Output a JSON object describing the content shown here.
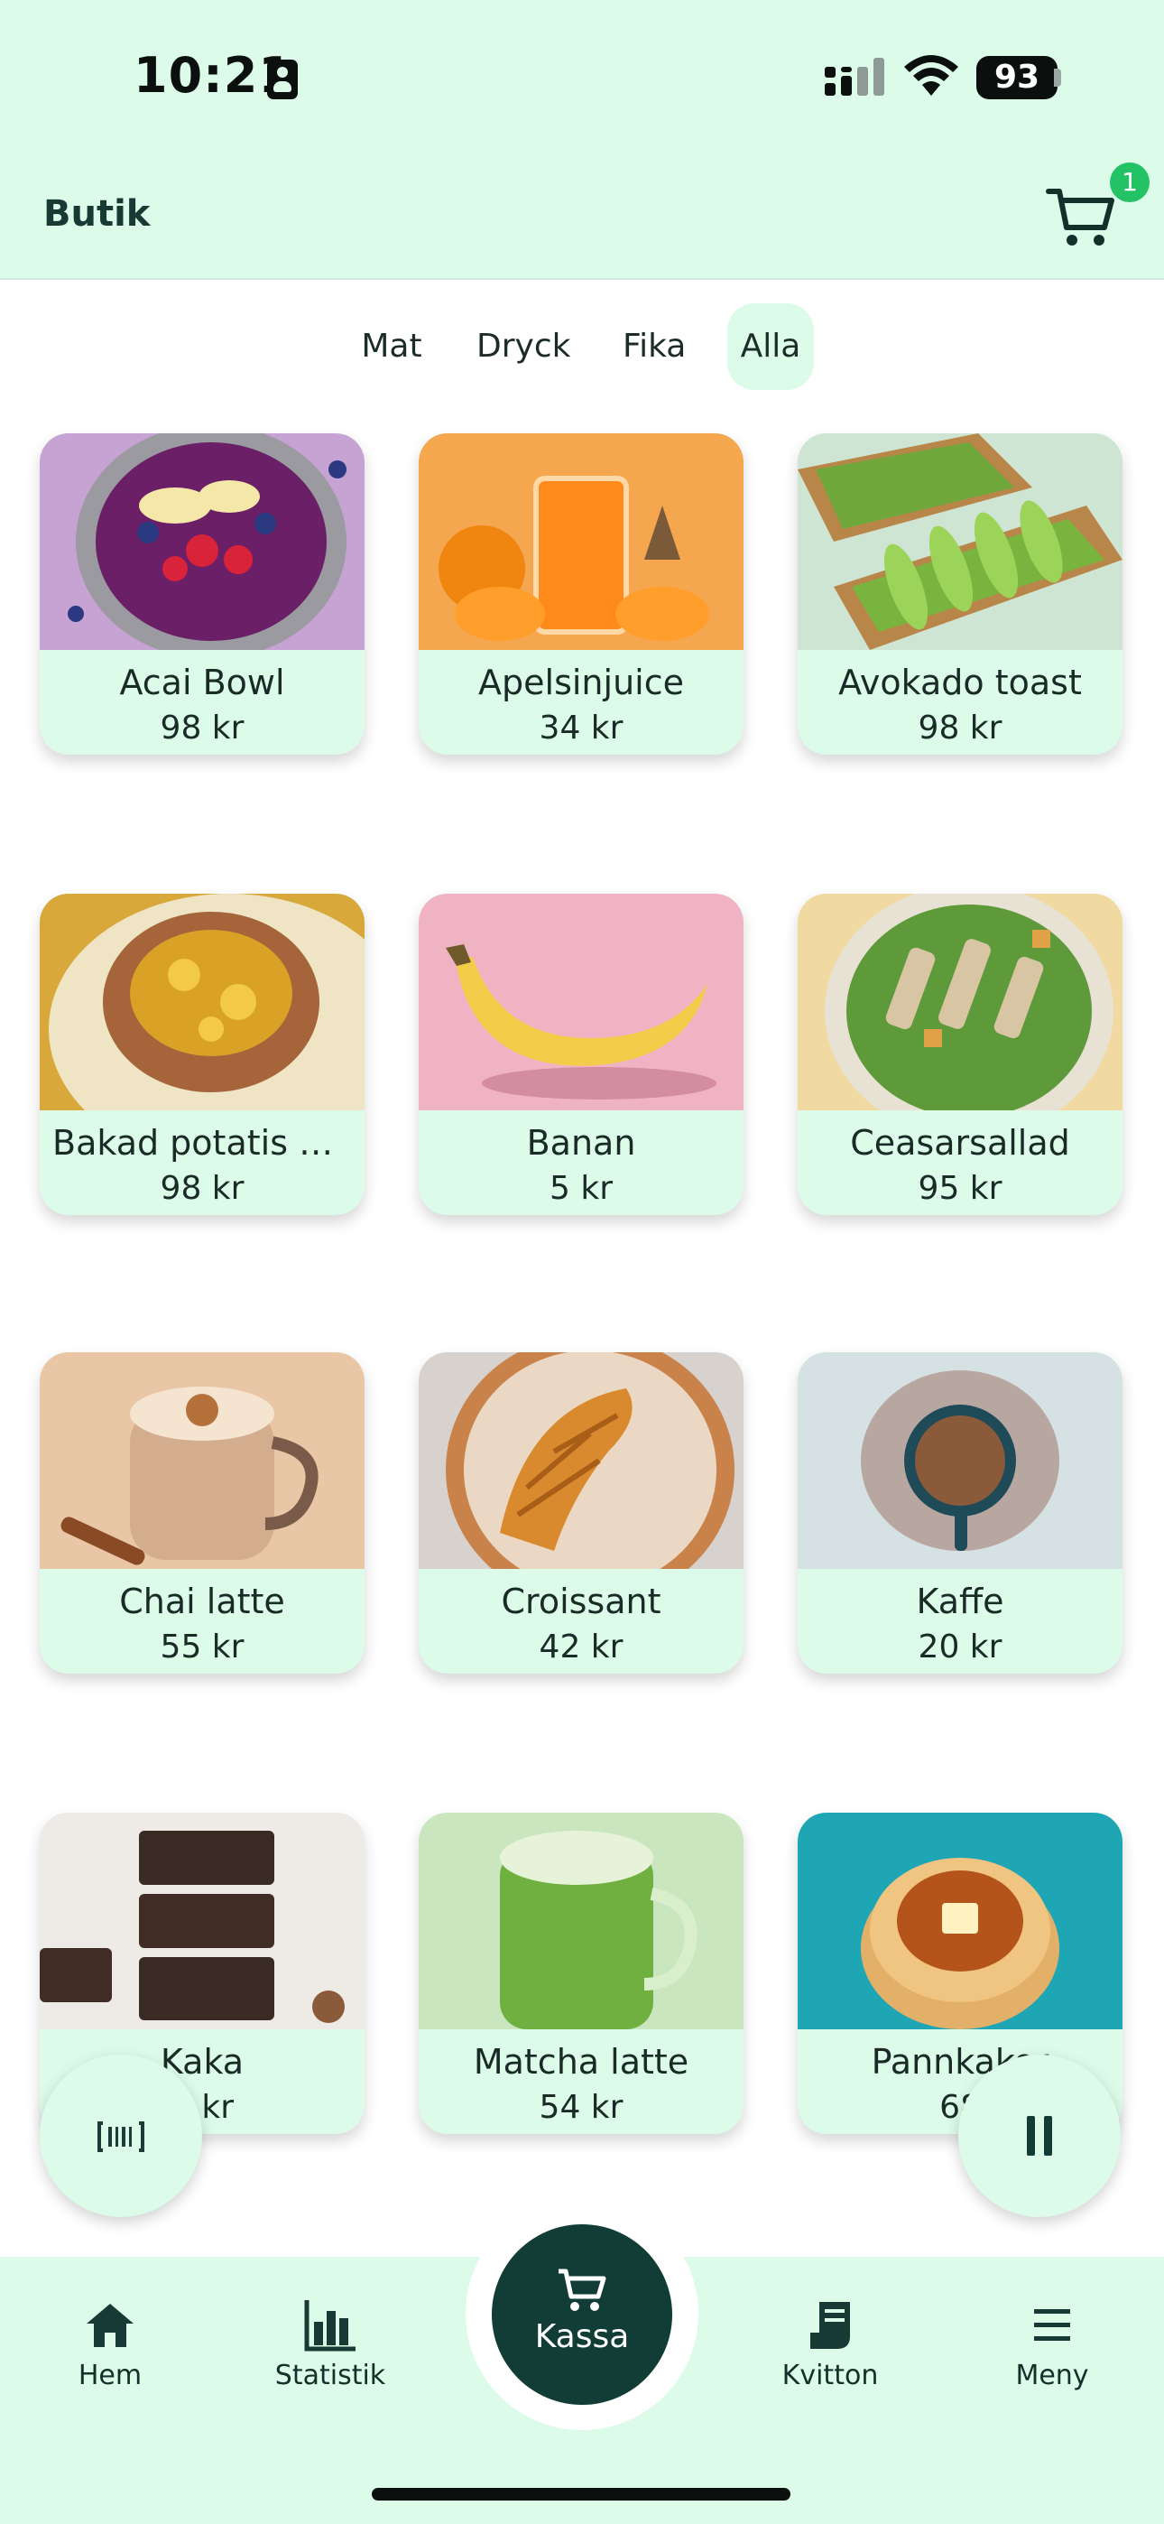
{
  "status_bar": {
    "time": "10:21",
    "battery": "93"
  },
  "header": {
    "title": "Butik",
    "cart_count": "1"
  },
  "tabs": [
    {
      "label": "Mat",
      "active": false
    },
    {
      "label": "Dryck",
      "active": false
    },
    {
      "label": "Fika",
      "active": false
    },
    {
      "label": "Alla",
      "active": true
    }
  ],
  "products": [
    {
      "name": "Acai Bowl",
      "price": "98 kr",
      "icon": "acai-bowl-image"
    },
    {
      "name": "Apelsinjuice",
      "price": "34 kr",
      "icon": "orange-juice-image"
    },
    {
      "name": "Avokado toast",
      "price": "98 kr",
      "icon": "avocado-toast-image"
    },
    {
      "name": "Bakad potatis m...",
      "price": "98 kr",
      "icon": "baked-potato-image"
    },
    {
      "name": "Banan",
      "price": "5 kr",
      "icon": "banana-image"
    },
    {
      "name": "Ceasarsallad",
      "price": "95 kr",
      "icon": "caesar-salad-image"
    },
    {
      "name": "Chai latte",
      "price": "55 kr",
      "icon": "chai-latte-image"
    },
    {
      "name": "Croissant",
      "price": "42 kr",
      "icon": "croissant-image"
    },
    {
      "name": "Kaffe",
      "price": "20 kr",
      "icon": "coffee-image"
    },
    {
      "name": "Kaka",
      "price": "0 kr",
      "icon": "cake-image"
    },
    {
      "name": "Matcha latte",
      "price": "54 kr",
      "icon": "matcha-latte-image"
    },
    {
      "name": "Pannkakor",
      "price": "68",
      "icon": "pancakes-image"
    }
  ],
  "fabs": {
    "scan_icon": "barcode-icon",
    "pause_icon": "pause-icon"
  },
  "bottom_nav": {
    "home": "Hem",
    "stats": "Statistik",
    "checkout": "Kassa",
    "receipts": "Kvitton",
    "menu": "Meny"
  },
  "colors": {
    "mint": "#dcfbe9",
    "dark_green": "#123d36",
    "badge_green": "#23c265"
  }
}
